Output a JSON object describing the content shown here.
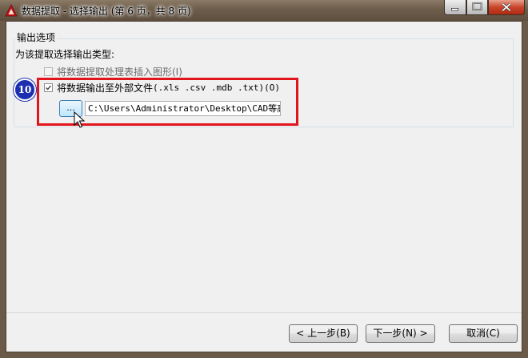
{
  "window": {
    "title": "数据提取 - 选择输出 (第 6 页，共 8 页)",
    "icon": "autocad-icon",
    "controls": [
      "minimize",
      "maximize",
      "close"
    ]
  },
  "output_options": {
    "group_label": "输出选项",
    "prompt": "为该提取选择输出类型:",
    "insert_table": {
      "label": "将数据提取处理表插入图形(I)",
      "checked": false,
      "enabled": false
    },
    "external_file": {
      "label": "将数据输出至外部文件",
      "extensions": " (.xls .csv .mdb .txt)(O)",
      "checked": true
    },
    "browse_label": "...",
    "file_path": "C:\\Users\\Administrator\\Desktop\\CAD等高线"
  },
  "annotation": {
    "step": "10",
    "highlight_color": "#e2141c",
    "badge_color": "#1b2fb0"
  },
  "buttons": {
    "back": "< 上一步(B)",
    "next": "下一步(N) >",
    "cancel": "取消(C)"
  }
}
